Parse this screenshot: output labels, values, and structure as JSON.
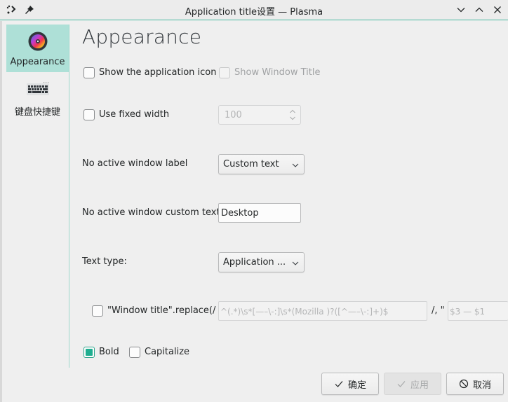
{
  "window": {
    "title": "Application title设置 — Plasma",
    "left_icons": [
      "app-menu-icon",
      "pin-icon"
    ],
    "right_controls": [
      "minimize-icon",
      "maximize-icon",
      "close-icon"
    ]
  },
  "sidebar": {
    "items": [
      {
        "label": "Appearance",
        "icon": "color-wheel-icon",
        "active": true
      },
      {
        "label": "键盘快捷键",
        "icon": "keyboard-icon",
        "active": false
      }
    ]
  },
  "page": {
    "title": "Appearance",
    "show_app_icon": {
      "label": "Show the application icon",
      "checked": false
    },
    "show_window_title": {
      "label": "Show Window Title",
      "checked": false,
      "disabled": true
    },
    "use_fixed_width": {
      "label": "Use fixed width",
      "checked": false
    },
    "fixed_width_value": "100",
    "no_active_label": {
      "label": "No active window label",
      "value": "Custom text"
    },
    "no_active_custom_text": {
      "label": "No active window custom text:",
      "value": "Desktop"
    },
    "text_type": {
      "label": "Text type:",
      "value": "Application ..."
    },
    "replace": {
      "label": "\"Window title\".replace(/",
      "checked": false,
      "pattern": "^(.*)\\s*[—–\\-:]\\s*(Mozilla )?([^—–\\-:]+)$",
      "separator": "/, \"",
      "replacement": "$3 — $1"
    },
    "bold": {
      "label": "Bold",
      "checked": true
    },
    "capitalize": {
      "label": "Capitalize",
      "checked": false
    }
  },
  "buttons": {
    "ok": {
      "label": "确定",
      "icon": "checkmark-icon"
    },
    "apply": {
      "label": "应用",
      "icon": "checkmark-icon",
      "disabled": true
    },
    "cancel": {
      "label": "取消",
      "icon": "cancel-icon"
    }
  },
  "colors": {
    "accent": "#1fae90",
    "sidebar_active": "#aee0d7",
    "background": "#efefef"
  }
}
